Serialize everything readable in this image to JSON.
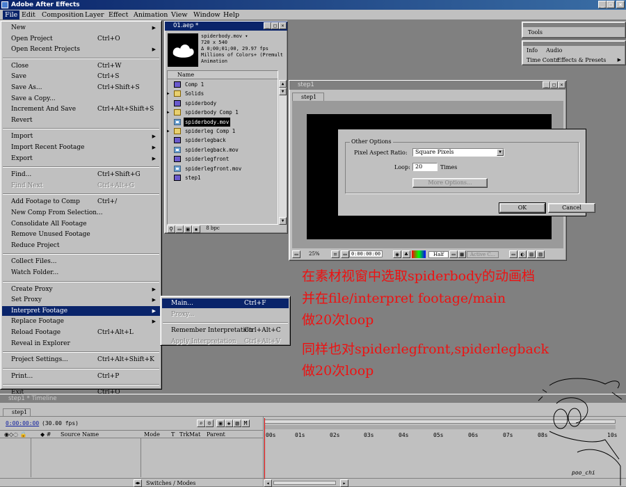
{
  "app": {
    "title": "Adobe After Effects"
  },
  "menubar": [
    "File",
    "Edit",
    "Composition",
    "Layer",
    "Effect",
    "Animation",
    "View",
    "Window",
    "Help"
  ],
  "file_menu": [
    {
      "label": "New",
      "shortcut": "",
      "arrow": true
    },
    {
      "label": "Open Project",
      "shortcut": "Ctrl+O"
    },
    {
      "label": "Open Recent Projects",
      "shortcut": "",
      "arrow": true
    },
    {
      "sep": true
    },
    {
      "label": "Close",
      "shortcut": "Ctrl+W"
    },
    {
      "label": "Save",
      "shortcut": "Ctrl+S"
    },
    {
      "label": "Save As...",
      "shortcut": "Ctrl+Shift+S"
    },
    {
      "label": "Save a Copy...",
      "shortcut": ""
    },
    {
      "label": "Increment And Save",
      "shortcut": "Ctrl+Alt+Shift+S"
    },
    {
      "label": "Revert",
      "shortcut": ""
    },
    {
      "sep": true
    },
    {
      "label": "Import",
      "shortcut": "",
      "arrow": true
    },
    {
      "label": "Import Recent Footage",
      "shortcut": "",
      "arrow": true
    },
    {
      "label": "Export",
      "shortcut": "",
      "arrow": true
    },
    {
      "sep": true
    },
    {
      "label": "Find...",
      "shortcut": "Ctrl+Shift+G"
    },
    {
      "label": "Find Next",
      "shortcut": "Ctrl+Alt+G",
      "disabled": true
    },
    {
      "sep": true
    },
    {
      "label": "Add Footage to Comp",
      "shortcut": "Ctrl+/"
    },
    {
      "label": "New Comp From Selection...",
      "shortcut": ""
    },
    {
      "label": "Consolidate All Footage",
      "shortcut": ""
    },
    {
      "label": "Remove Unused Footage",
      "shortcut": ""
    },
    {
      "label": "Reduce Project",
      "shortcut": ""
    },
    {
      "sep": true
    },
    {
      "label": "Collect Files...",
      "shortcut": ""
    },
    {
      "label": "Watch Folder...",
      "shortcut": ""
    },
    {
      "sep": true
    },
    {
      "label": "Create Proxy",
      "shortcut": "",
      "arrow": true
    },
    {
      "label": "Set Proxy",
      "shortcut": "",
      "arrow": true
    },
    {
      "label": "Interpret Footage",
      "shortcut": "",
      "arrow": true,
      "highlight": true
    },
    {
      "label": "Replace Footage",
      "shortcut": "",
      "arrow": true
    },
    {
      "label": "Reload Footage",
      "shortcut": "Ctrl+Alt+L"
    },
    {
      "label": "Reveal in Explorer",
      "shortcut": ""
    },
    {
      "sep": true
    },
    {
      "label": "Project Settings...",
      "shortcut": "Ctrl+Alt+Shift+K"
    },
    {
      "sep": true
    },
    {
      "label": "Print...",
      "shortcut": "Ctrl+P"
    },
    {
      "sep": true
    },
    {
      "label": "Exit",
      "shortcut": "Ctrl+Q"
    }
  ],
  "submenu": [
    {
      "label": "Main...",
      "shortcut": "Ctrl+F",
      "highlight": true
    },
    {
      "label": "Proxy...",
      "shortcut": "",
      "disabled": true
    },
    {
      "sep": true
    },
    {
      "label": "Remember Interpretation",
      "shortcut": "Ctrl+Alt+C"
    },
    {
      "label": "Apply Interpretation",
      "shortcut": "Ctrl+Alt+V",
      "disabled": true
    }
  ],
  "project": {
    "title": "01.aep *",
    "footage_name": "spiderbody.mov ▾",
    "info": [
      "720 x 540",
      "Δ 0;00;01;00, 29.97 fps",
      "Millions of Colors+ (Premult",
      "Animation"
    ],
    "col_name": "Name",
    "items": [
      {
        "name": "Comp 1",
        "type": "comp",
        "twirl": ""
      },
      {
        "name": "Solids",
        "type": "folder",
        "twirl": "▶"
      },
      {
        "name": "spiderbody",
        "type": "comp",
        "twirl": ""
      },
      {
        "name": "spiderbody Comp 1",
        "type": "folder",
        "twirl": "▶"
      },
      {
        "name": "spiderbody.mov",
        "type": "mov",
        "twirl": "",
        "selected": true
      },
      {
        "name": "spiderleg Comp 1",
        "type": "folder",
        "twirl": "▶"
      },
      {
        "name": "spiderlegback",
        "type": "comp",
        "twirl": ""
      },
      {
        "name": "spiderlegback.mov",
        "type": "mov",
        "twirl": ""
      },
      {
        "name": "spiderlegfront",
        "type": "comp",
        "twirl": ""
      },
      {
        "name": "spiderlegfront.mov",
        "type": "mov",
        "twirl": ""
      },
      {
        "name": "step1",
        "type": "comp",
        "twirl": ""
      }
    ],
    "bpc": "8 bpc"
  },
  "comp": {
    "title": "step1",
    "tab": "step1",
    "zoom": "25%",
    "timecode": "0:00:00:00",
    "resolution": "Half",
    "camera": "Active C..."
  },
  "dialog": {
    "group": "Other Options",
    "par_label": "Pixel Aspect Ratio:",
    "par_value": "Square Pixels",
    "loop_label": "Loop:",
    "loop_value": "20",
    "loop_unit": "Times",
    "more_options": "More Options...",
    "ok": "OK",
    "cancel": "Cancel"
  },
  "panels": {
    "tools": "Tools",
    "info": "Info",
    "audio": "Audio",
    "time_controls": "Time Contr",
    "effects": "Effects & Presets"
  },
  "timeline": {
    "title": "step1 * Timeline",
    "tab": "step1",
    "timecode": "0:00:00:00",
    "fps": "(30.00 fps)",
    "cols": [
      "Source Name",
      "Mode",
      "T",
      "TrkMat",
      "Parent"
    ],
    "ticks": [
      "00s",
      "01s",
      "02s",
      "03s",
      "04s",
      "05s",
      "06s",
      "07s",
      "08s",
      "10s"
    ],
    "switches": "Switches / Modes"
  },
  "annotation": {
    "line1": "在素材视窗中选取spiderbody的动画档",
    "line2": "并在file/interpret footage/main",
    "line3": "做20次loop",
    "line4": "同样也对spiderlegfront,spiderlegback",
    "line5": "做20次loop"
  },
  "signature": "poo_chi"
}
